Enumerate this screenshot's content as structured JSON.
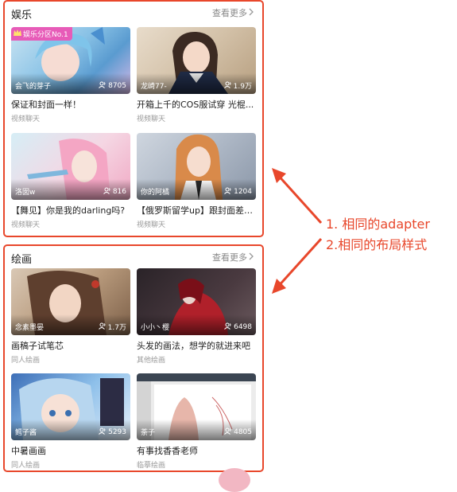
{
  "sections": [
    {
      "title": "娱乐",
      "more": "查看更多",
      "badge": "娱乐分区No.1",
      "cards": [
        {
          "author": "会飞的芽子",
          "count": "8705",
          "title": "保证和封面一样！",
          "sub": "视频聊天"
        },
        {
          "author": "龙崎77-",
          "count": "1.9万",
          "title": "开箱上千的COS服试穿 光棍...",
          "sub": "视频聊天"
        },
        {
          "author": "洛囡w",
          "count": "816",
          "title": "【舞见】你是我的darling吗?",
          "sub": "视频聊天"
        },
        {
          "author": "你的阿橘",
          "count": "1204",
          "title": "【俄罗斯留学up】跟封面差不...",
          "sub": "视频聊天"
        }
      ]
    },
    {
      "title": "绘画",
      "more": "查看更多",
      "cards": [
        {
          "author": "念素墨晏",
          "count": "1.7万",
          "title": "画稿子试笔芯",
          "sub": "同人绘画"
        },
        {
          "author": "小小丶樱",
          "count": "6498",
          "title": "头发的画法，想学的就进来吧",
          "sub": "其他绘画"
        },
        {
          "author": "鳕子酱",
          "count": "5293",
          "title": "中暑画画",
          "sub": "同人绘画"
        },
        {
          "author": "荼子",
          "count": "4805",
          "title": "有事找香香老师",
          "sub": "临摹绘画"
        }
      ]
    }
  ],
  "annotation": {
    "line1": "1. 相同的adapter",
    "line2": "2.相同的布局样式",
    "color": "#e8472b"
  },
  "colors": {
    "border": "#e8472b",
    "badge": "#e75bb8"
  }
}
